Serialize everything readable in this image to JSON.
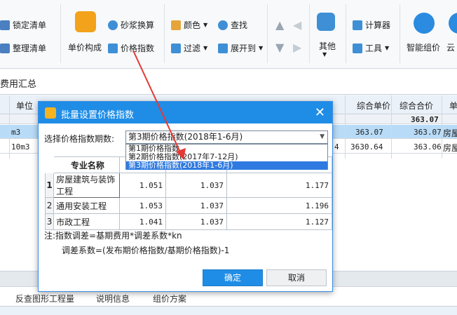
{
  "ribbon": {
    "lock_list": "锁定清单",
    "tidy_list": "整理清单",
    "unit_price_comp": "单价构成",
    "mortar_convert": "砂浆换算",
    "price_index": "价格指数",
    "color": "颜色",
    "filter": "过滤",
    "find": "查找",
    "expand_to": "展开到",
    "other": "其他",
    "calculator": "计算器",
    "tools": "工具",
    "smart_price": "智能组价",
    "cloud": "云"
  },
  "tabbar": {
    "active_tab": "费用汇总"
  },
  "grid": {
    "headers": [
      "单位",
      "综合单价",
      "综合合价",
      "单"
    ],
    "total_row": {
      "combined_total": "363.07"
    },
    "rows": [
      {
        "unit": "m3",
        "unit_price": "363.07",
        "total": "363.07",
        "tail": "房屋"
      },
      {
        "unit": "10m3",
        "mid": "4",
        "unit_price": "3630.64",
        "total": "363.06",
        "tail": "房屋"
      }
    ]
  },
  "bottom_tabs": [
    "反查图形工程量",
    "说明信息",
    "组价方案"
  ],
  "dialog": {
    "title": "批量设置价格指数",
    "select_label": "选择价格指数期数:",
    "selected_value": "第3期价格指数(2018年1-6月)",
    "options": [
      "第1期价格指数",
      "第2期价格指数(2017年7-12月)",
      "第3期价格指数(2018年1-6月)"
    ],
    "table_header": "专业名称",
    "rows": [
      {
        "n": "1",
        "name": "房屋建筑与装饰工程",
        "v1": "1.051",
        "v2": "1.037",
        "v3": "1.177"
      },
      {
        "n": "2",
        "name": "通用安装工程",
        "v1": "1.053",
        "v2": "1.037",
        "v3": "1.196"
      },
      {
        "n": "3",
        "name": "市政工程",
        "v1": "1.041",
        "v2": "1.037",
        "v3": "1.127"
      }
    ],
    "note_line1": "注:指数调差=基期费用*调差系数*kn",
    "note_line2": "调差系数=(发布期价格指数/基期价格指数)-1",
    "ok_label": "确定",
    "cancel_label": "取消"
  },
  "colors": {
    "accent": "#1f8de6",
    "selection": "#2f7ae0",
    "annotation_arrow": "#e53935"
  }
}
